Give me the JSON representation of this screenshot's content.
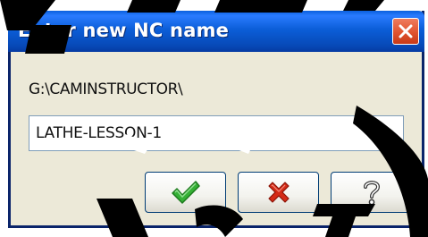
{
  "dialog": {
    "title": "Enter new NC name",
    "path_label": "G:\\CAMINSTRUCTOR\\",
    "name_value": "LATHE-LESSON-1"
  },
  "buttons": {
    "close_icon": "close-x-icon",
    "ok_icon": "green-checkmark-icon",
    "cancel_icon": "red-x-icon",
    "help_icon": "question-mark-icon"
  },
  "colors": {
    "titlebar": "#0b5ed8",
    "close_button": "#e0532f",
    "dialog_background": "#ece9d8",
    "ok_check": "#2ea82e",
    "cancel_x": "#d42a16"
  }
}
